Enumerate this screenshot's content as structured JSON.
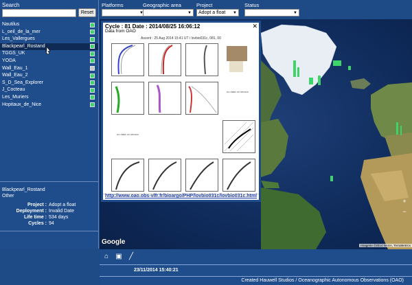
{
  "search": {
    "label": "Search",
    "placeholder": "",
    "reset_label": "Reset"
  },
  "platforms": [
    {
      "name": "Nautilus",
      "color": "#3ed46a"
    },
    {
      "name": "L_oeil_de_la_mer",
      "color": "#3ed46a"
    },
    {
      "name": "Les_Vallergues",
      "color": "#3ed46a"
    },
    {
      "name": "Blackpearl_Rostand",
      "color": "#3ed46a",
      "selected": true
    },
    {
      "name": "TGGS_UK",
      "color": "#3ed46a"
    },
    {
      "name": "YODA",
      "color": "#3ed46a"
    },
    {
      "name": "Wall_Eau_1",
      "color": "#c8c8c8"
    },
    {
      "name": "Wall_Eau_2",
      "color": "#3ed46a"
    },
    {
      "name": "S_D_Sea_Explorer",
      "color": "#3ed46a"
    },
    {
      "name": "J_Cocteau",
      "color": "#3ed46a"
    },
    {
      "name": "Les_Muriers",
      "color": "#3ed46a"
    },
    {
      "name": "Hopitaux_de_Nice",
      "color": "#3ed46a"
    }
  ],
  "info": {
    "name": "Blackpearl_Rostand",
    "category": "Other",
    "project_label": "Project :",
    "project": "Adopt a float",
    "deployment_label": "Deployment :",
    "deployment": "Invalid Date",
    "lifetime_label": "Life time :",
    "lifetime": "534 days",
    "cycles_label": "Cycles :",
    "cycles": "94"
  },
  "filters": {
    "platforms_label": "Platforms",
    "geo_label": "Geographic area",
    "project_label": "Project",
    "project_value": "Adopt a float",
    "status_label": "Status"
  },
  "popup": {
    "title": "Cycle : 81 Date : 2014/08/25 16:06:12",
    "subtitle": "Data from OAO",
    "plot_header": "Ascent : 25 Aug 2014 15:41 UT / lovbio031c, 081, 00",
    "link": "http://www.oao.obs-vlfr.fr/bioargo/PHP/lovbio031c/lovbio031c.html",
    "no_data_1": "no data on sensor",
    "no_data_2": "no data on sensor"
  },
  "map": {
    "google_label": "Google",
    "attribution": "Imagerie ©2014 NASA, TerraMetrics"
  },
  "bottom": {
    "time": "23/11/2014 15:40:21",
    "credit": "Created Hauwell Studios / Oceanographic Autonomous Observations (OAO)"
  },
  "colors": {
    "accent": "#1f4d8c",
    "float_green": "#3ed46a"
  },
  "icons": {
    "home": "home-icon",
    "layers": "layers-icon",
    "ruler": "ruler-icon"
  }
}
